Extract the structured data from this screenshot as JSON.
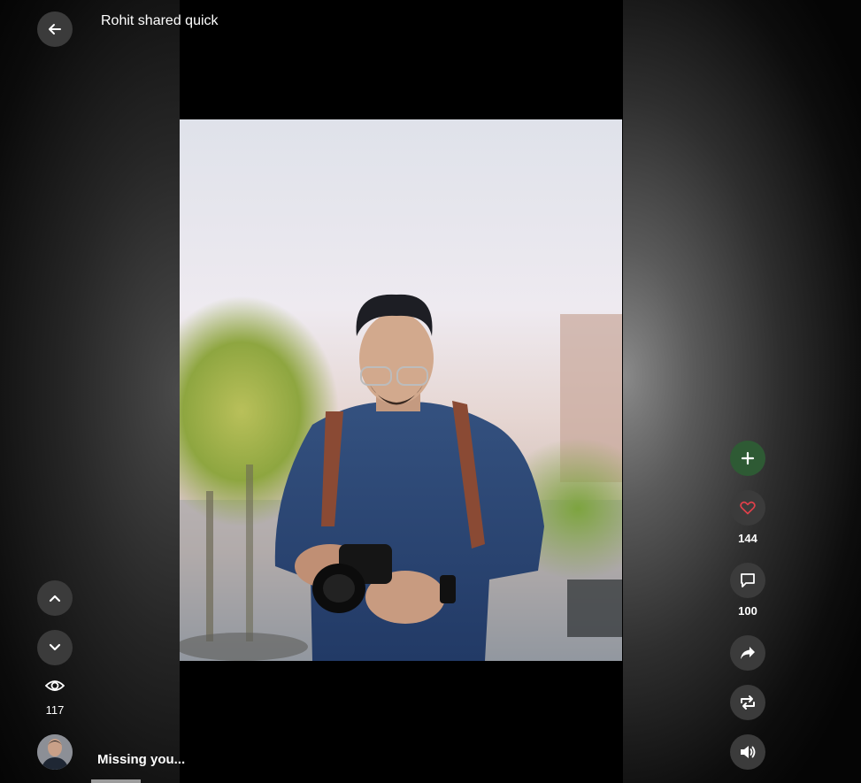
{
  "header": {
    "title": "Rohit shared quick"
  },
  "video": {
    "caption": "Missing you..."
  },
  "stats": {
    "views": "117",
    "likes": "144",
    "comments": "100"
  },
  "icons": {
    "back": "arrow-left-icon",
    "up": "chevron-up-icon",
    "down": "chevron-down-icon",
    "views": "eye-icon",
    "follow": "plus-icon",
    "like": "heart-icon",
    "comment": "comment-icon",
    "share": "share-icon",
    "repost": "repost-icon",
    "sound": "volume-icon"
  },
  "colors": {
    "button_bg": "#3b3b3b",
    "follow_bg": "#2e5a34",
    "heart": "#e0404a"
  }
}
